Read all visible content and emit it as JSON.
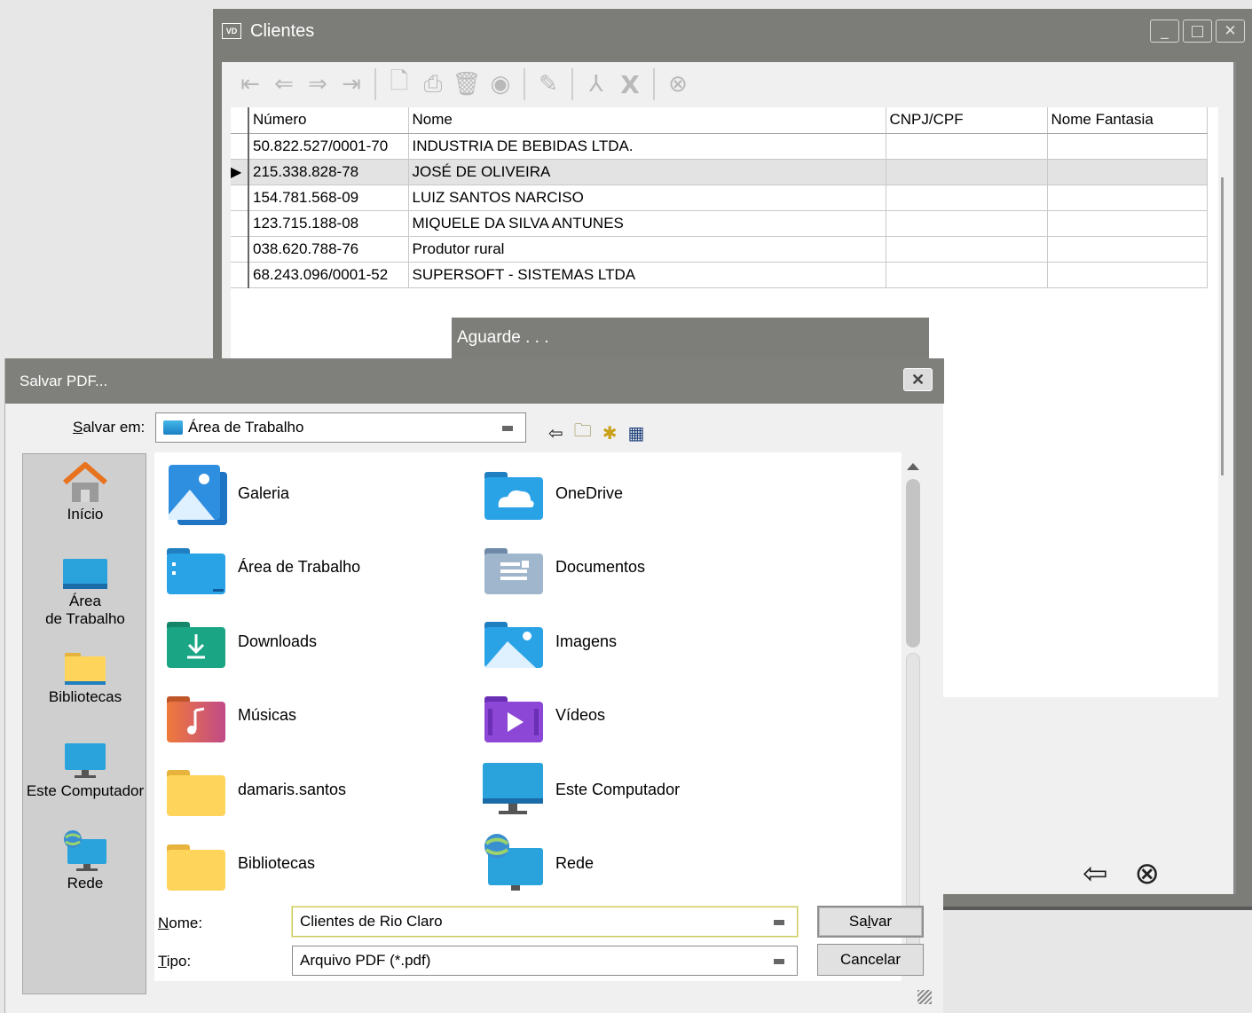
{
  "clientes_window": {
    "title": "Clientes",
    "app_badge": "VD",
    "window_buttons": [
      "_",
      "□",
      "✕"
    ],
    "columns": [
      "Número",
      "Nome",
      "CNPJ/CPF",
      "Nome Fantasia"
    ],
    "rows": [
      {
        "numero": "50.822.527/0001-70",
        "nome": "INDUSTRIA DE BEBIDAS LTDA.",
        "cnpj": "",
        "fantasia": ""
      },
      {
        "numero": "215.338.828-78",
        "nome": "JOSÉ DE OLIVEIRA",
        "cnpj": "",
        "fantasia": ""
      },
      {
        "numero": "154.781.568-09",
        "nome": "LUIZ SANTOS NARCISO",
        "cnpj": "",
        "fantasia": ""
      },
      {
        "numero": "123.715.188-08",
        "nome": "MIQUELE DA SILVA ANTUNES",
        "cnpj": "",
        "fantasia": ""
      },
      {
        "numero": "038.620.788-76",
        "nome": "Produtor rural",
        "cnpj": "",
        "fantasia": ""
      },
      {
        "numero": "68.243.096/0001-52",
        "nome": "SUPERSOFT - SISTEMAS LTDA",
        "cnpj": "",
        "fantasia": ""
      }
    ],
    "selected_row": 1,
    "toolbar_icons": [
      "first-icon",
      "previous-icon",
      "next-icon",
      "last-icon",
      "new-document-icon",
      "print-icon",
      "delete-icon",
      "view-icon",
      "edit-icon",
      "pdf-icon",
      "excel-icon",
      "cancel-icon"
    ],
    "footer_icons": [
      "back-arrow-icon",
      "close-circle-icon"
    ]
  },
  "aguarde": {
    "title": "Aguarde . . ."
  },
  "save_dialog": {
    "title": "Salvar PDF...",
    "close": "✕",
    "save_in_label_u": "S",
    "save_in_label_rest": "alvar em:",
    "save_in_value": "Área de Trabalho",
    "nav_icons": [
      "back-icon",
      "up-folder-icon",
      "new-folder-icon",
      "view-menu-icon"
    ],
    "places": [
      {
        "label": "Início",
        "icon": "home-icon"
      },
      {
        "label": "Área\nde Trabalho",
        "icon": "desktop-icon"
      },
      {
        "label": "Bibliotecas",
        "icon": "libraries-icon"
      },
      {
        "label": "Este Computador",
        "icon": "computer-icon"
      },
      {
        "label": "Rede",
        "icon": "network-icon"
      }
    ],
    "files": [
      {
        "label": "Galeria",
        "icon": "gallery-icon"
      },
      {
        "label": "OneDrive",
        "icon": "onedrive-icon"
      },
      {
        "label": "Área de Trabalho",
        "icon": "desktop-folder-icon"
      },
      {
        "label": "Documentos",
        "icon": "documents-icon"
      },
      {
        "label": "Downloads",
        "icon": "downloads-icon"
      },
      {
        "label": "Imagens",
        "icon": "images-icon"
      },
      {
        "label": "Músicas",
        "icon": "music-icon"
      },
      {
        "label": "Vídeos",
        "icon": "videos-icon"
      },
      {
        "label": "damaris.santos",
        "icon": "user-folder-icon"
      },
      {
        "label": "Este Computador",
        "icon": "computer-icon"
      },
      {
        "label": "Bibliotecas",
        "icon": "libraries-folder-icon"
      },
      {
        "label": "Rede",
        "icon": "network-icon"
      }
    ],
    "name_label_u": "N",
    "name_label_rest": "ome:",
    "name_value": "Clientes de Rio Claro",
    "type_label_u": "T",
    "type_label_rest": "ipo:",
    "type_value": "Arquivo PDF (*.pdf)",
    "save_button_pre": "Sa",
    "save_button_u": "l",
    "save_button_post": "var",
    "cancel_button": "Cancelar"
  }
}
